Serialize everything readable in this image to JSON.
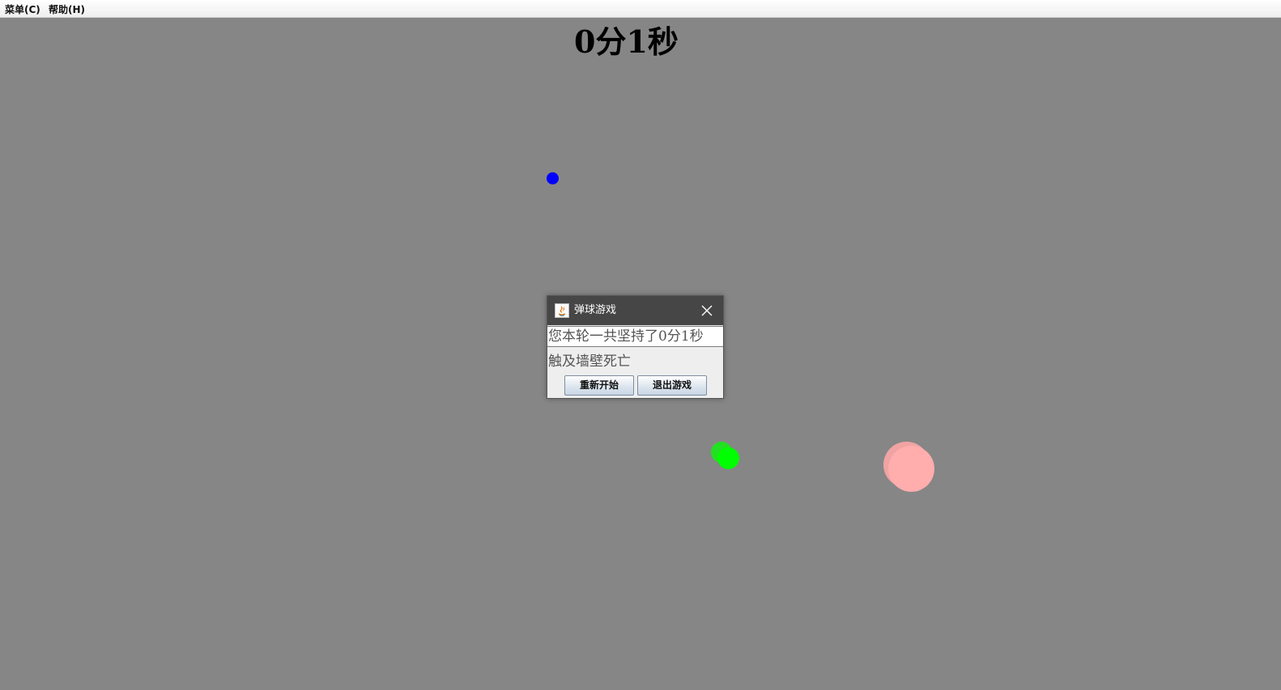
{
  "menubar": {
    "items": [
      {
        "label": "菜单(C)"
      },
      {
        "label": "帮助(H)"
      }
    ]
  },
  "game": {
    "timer": "0分1秒",
    "balls": [
      {
        "name": "blue-ball",
        "color": "#0000ff"
      },
      {
        "name": "green-ball",
        "color": "#00ff00"
      },
      {
        "name": "pink-ball",
        "color": "#ffadad"
      }
    ]
  },
  "dialog": {
    "title": "弹球游戏",
    "icon": "java-icon",
    "message": "您本轮一共坚持了0分1秒",
    "reason": "触及墙壁死亡",
    "restart_label": "重新开始",
    "quit_label": "退出游戏"
  },
  "colors": {
    "background": "#868686",
    "dialog_titlebar": "#464646"
  }
}
